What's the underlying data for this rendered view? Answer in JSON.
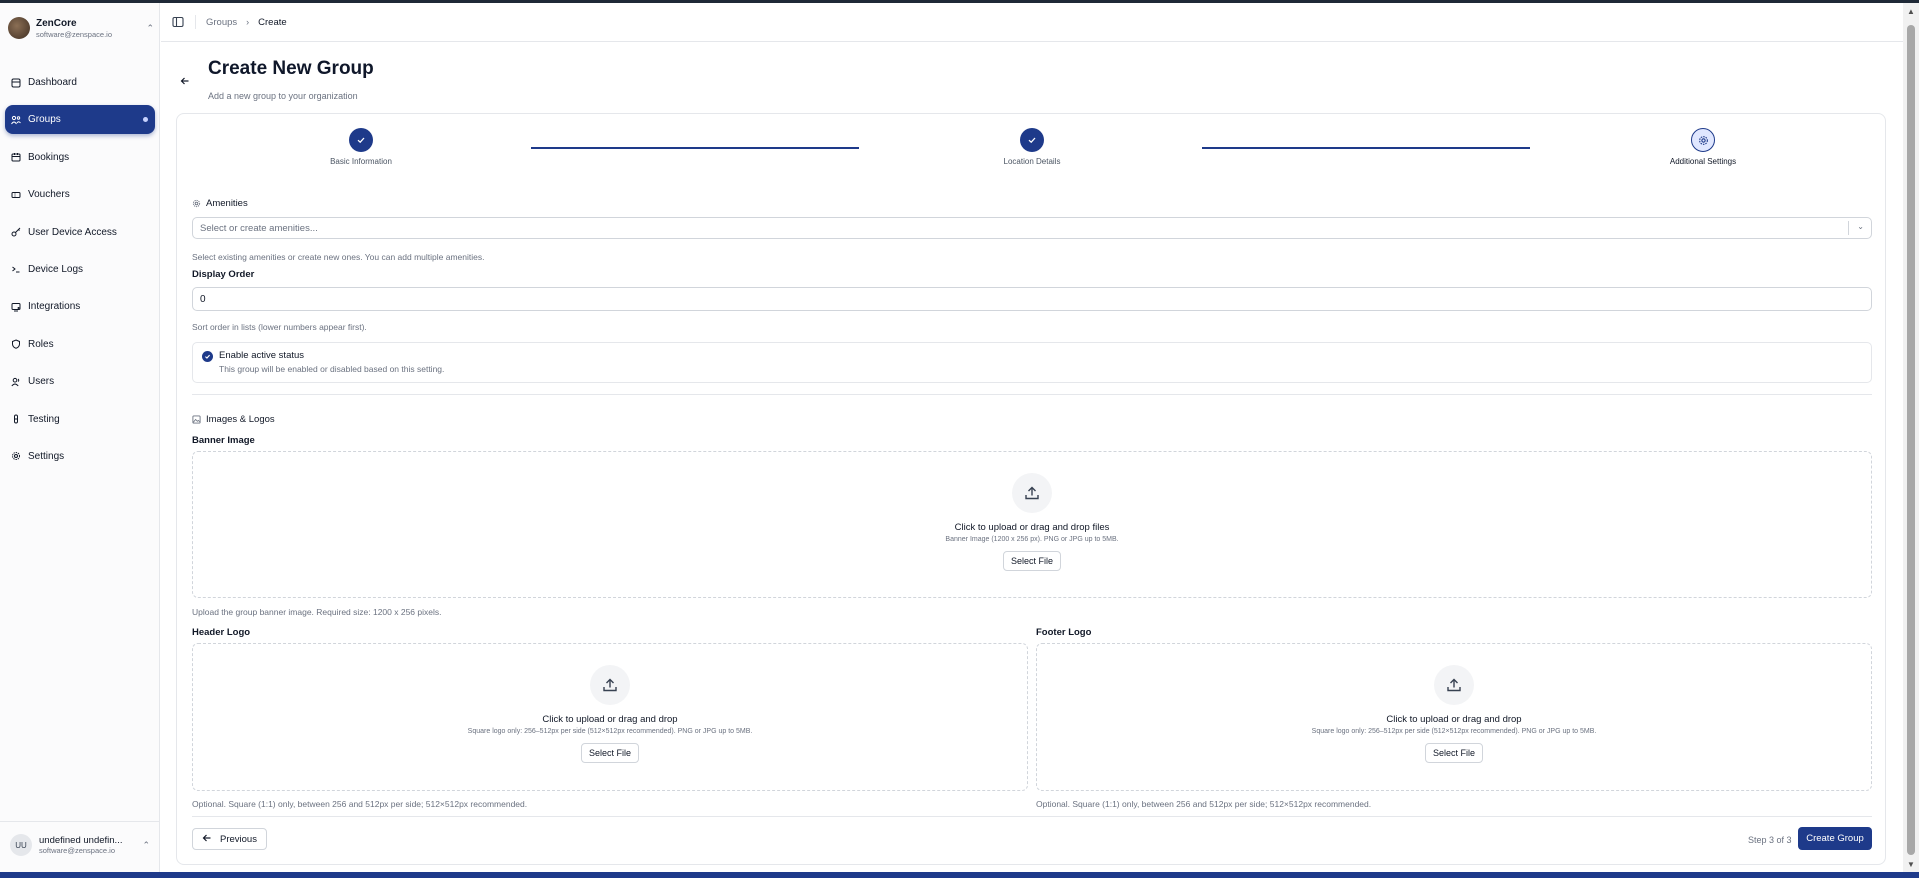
{
  "org": {
    "name": "ZenCore",
    "email": "software@zenspace.io"
  },
  "nav": {
    "items": [
      {
        "label": "Dashboard",
        "icon": "home-icon"
      },
      {
        "label": "Groups",
        "icon": "groups-icon",
        "active": true
      },
      {
        "label": "Bookings",
        "icon": "calendar-icon"
      },
      {
        "label": "Vouchers",
        "icon": "ticket-icon"
      },
      {
        "label": "User Device Access",
        "icon": "key-icon"
      },
      {
        "label": "Device Logs",
        "icon": "terminal-icon"
      },
      {
        "label": "Integrations",
        "icon": "plug-icon"
      },
      {
        "label": "Roles",
        "icon": "shield-icon"
      },
      {
        "label": "Users",
        "icon": "users-icon"
      },
      {
        "label": "Testing",
        "icon": "flask-icon"
      },
      {
        "label": "Settings",
        "icon": "gear-icon"
      }
    ]
  },
  "user": {
    "initials": "UU",
    "name": "undefined undefin...",
    "email": "software@zenspace.io"
  },
  "breadcrumb": {
    "items": [
      "Groups",
      "Create"
    ]
  },
  "page": {
    "title": "Create New Group",
    "subtitle": "Add a new group to your organization"
  },
  "stepper": {
    "steps": [
      {
        "label": "Basic Information",
        "status": "done"
      },
      {
        "label": "Location Details",
        "status": "done"
      },
      {
        "label": "Additional Settings",
        "status": "current"
      }
    ]
  },
  "amenities": {
    "section_title": "Amenities",
    "placeholder": "Select or create amenities...",
    "help": "Select existing amenities or create new ones. You can add multiple amenities."
  },
  "display_order": {
    "label": "Display Order",
    "value": "0",
    "help": "Sort order in lists (lower numbers appear first)."
  },
  "active_status": {
    "label": "Enable active status",
    "description": "This group will be enabled or disabled based on this setting.",
    "checked": true
  },
  "images": {
    "section_title": "Images & Logos",
    "banner": {
      "label": "Banner Image",
      "title": "Click to upload or drag and drop files",
      "desc": "Banner Image (1200 x 256 px). PNG or JPG up to 5MB.",
      "button": "Select File",
      "help": "Upload the group banner image. Required size: 1200 x 256 pixels."
    },
    "header_logo": {
      "label": "Header Logo",
      "title": "Click to upload or drag and drop",
      "desc": "Square logo only: 256–512px per side (512×512px recommended). PNG or JPG up to 5MB.",
      "button": "Select File",
      "help": "Optional. Square (1:1) only, between 256 and 512px per side; 512×512px recommended."
    },
    "footer_logo": {
      "label": "Footer Logo",
      "title": "Click to upload or drag and drop",
      "desc": "Square logo only: 256–512px per side (512×512px recommended). PNG or JPG up to 5MB.",
      "button": "Select File",
      "help": "Optional. Square (1:1) only, between 256 and 512px per side; 512×512px recommended."
    }
  },
  "footer": {
    "previous": "Previous",
    "step_text": "Step 3 of 3",
    "create": "Create Group"
  },
  "colors": {
    "primary": "#1e3a8a",
    "border": "#e5e7eb",
    "muted": "#6b7280"
  }
}
